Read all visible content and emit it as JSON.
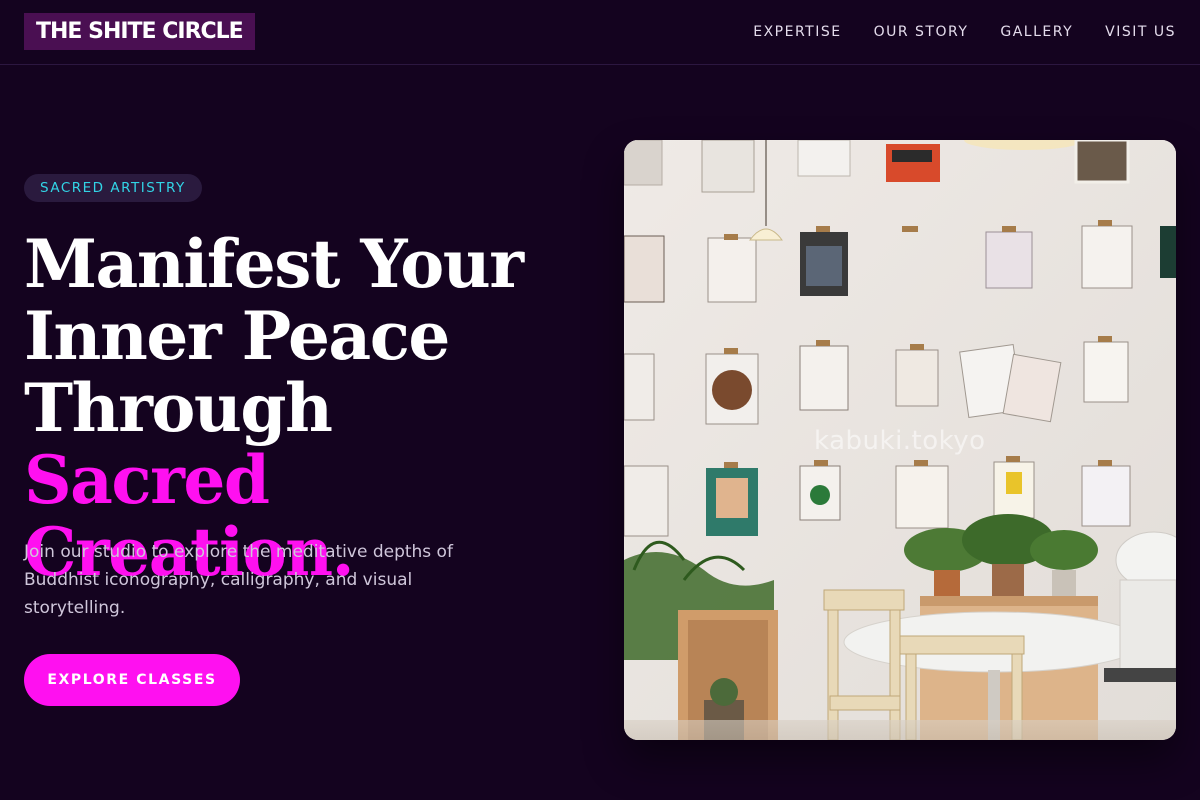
{
  "header": {
    "logo_text": "THE SHITE CIRCLE",
    "nav": [
      {
        "label": "EXPERTISE"
      },
      {
        "label": "OUR STORY"
      },
      {
        "label": "GALLERY"
      },
      {
        "label": "VISIT US"
      }
    ]
  },
  "hero": {
    "badge": "SACRED ARTISTRY",
    "headline_line1": "Manifest Your",
    "headline_line2": "Inner Peace",
    "headline_line3_plain": "Through ",
    "headline_line3_accent": "Sacred",
    "headline_line4_accent": "Creation.",
    "description": "Join our studio to explore the meditative depths of Buddhist iconography, calligraphy, and visual storytelling.",
    "cta_label": "EXPLORE CLASSES",
    "image": {
      "subject": "cafe wall with clipboards of magazines, pendant lamp, plants and a round white table",
      "watermark": "kabuki.tokyo"
    }
  },
  "colors": {
    "background": "#14031f",
    "accent_magenta": "#ff10f0",
    "badge_text": "#32d4e6",
    "logo_bg": "#4a0f52"
  }
}
